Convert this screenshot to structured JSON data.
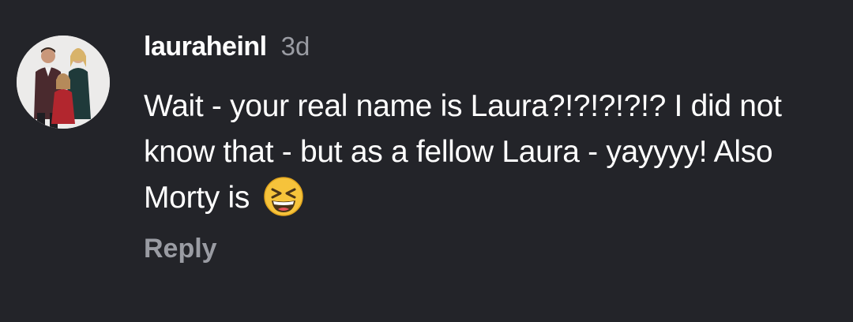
{
  "comment": {
    "username": "lauraheinl",
    "timestamp": "3d",
    "text": "Wait - your real name is Laura?!?!?!?!? I did not know that - but as a fellow Laura - yayyyy! Also Morty is",
    "emoji": "grinning-squinting-face-emoji",
    "reply_label": "Reply"
  },
  "colors": {
    "background": "#232429",
    "text_primary": "#ffffff",
    "text_secondary": "#9a9ca3"
  }
}
